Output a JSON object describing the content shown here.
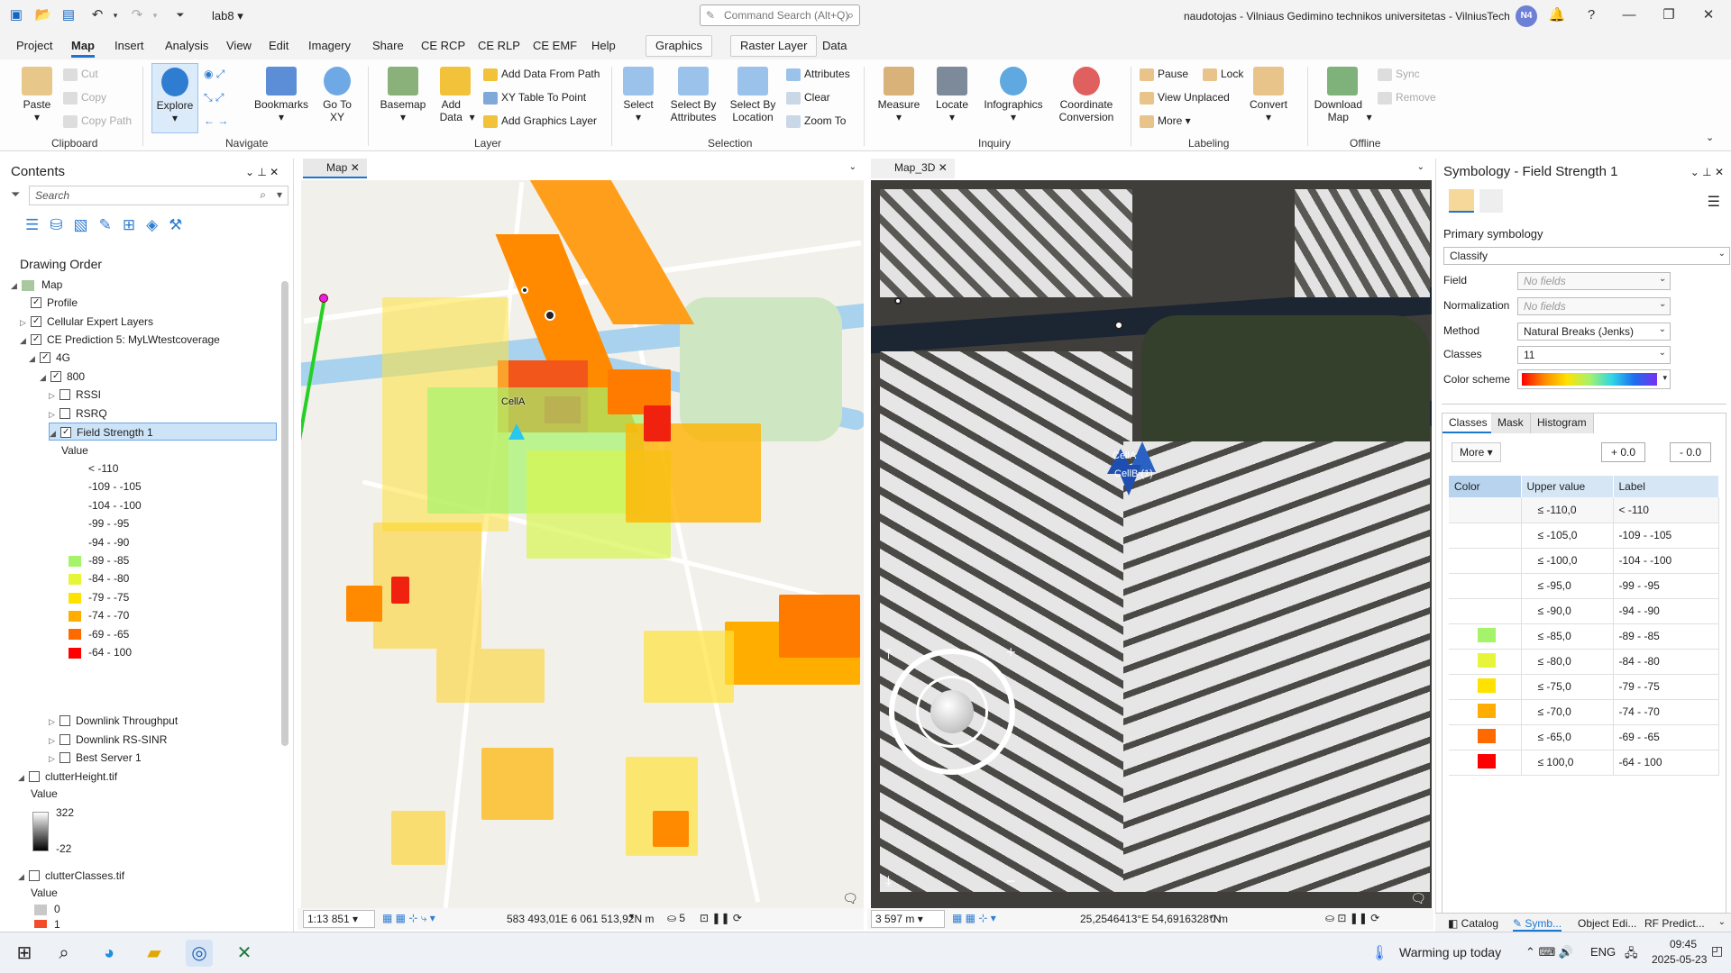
{
  "app": {
    "project": "lab8",
    "command_search": "Command Search (Alt+Q)",
    "user": "naudotojas - Vilniaus Gedimino technikos universitetas - VilniusTech",
    "avatar": "N4"
  },
  "tabs": [
    "Project",
    "Map",
    "Insert",
    "Analysis",
    "View",
    "Edit",
    "Imagery",
    "Share",
    "CE RCP",
    "CE RLP",
    "CE EMF",
    "Help"
  ],
  "context_tabs": [
    "Graphics",
    "Raster Layer",
    "Data"
  ],
  "ribbon": {
    "clipboard": {
      "paste": "Paste",
      "cut": "Cut",
      "copy": "Copy",
      "copy_path": "Copy Path",
      "group": "Clipboard"
    },
    "navigate": {
      "explore": "Explore",
      "bookmarks": "Bookmarks",
      "go_to_xy": "Go To XY",
      "group": "Navigate"
    },
    "layer": {
      "basemap": "Basemap",
      "add_data": "Add Data",
      "add_data_from_path": "Add Data From Path",
      "xy_table": "XY Table To Point",
      "add_graphics": "Add Graphics Layer",
      "group": "Layer"
    },
    "selection": {
      "select": "Select",
      "select_by_attr": "Select By Attributes",
      "select_by_loc": "Select By Location",
      "attributes": "Attributes",
      "clear": "Clear",
      "zoom_to": "Zoom To",
      "group": "Selection"
    },
    "inquiry": {
      "measure": "Measure",
      "locate": "Locate",
      "infographics": "Infographics",
      "coord_conv": "Coordinate Conversion",
      "group": "Inquiry"
    },
    "labeling": {
      "pause": "Pause",
      "lock": "Lock",
      "view_unplaced": "View Unplaced",
      "more": "More",
      "convert": "Convert",
      "group": "Labeling"
    },
    "offline": {
      "download_map": "Download Map",
      "sync": "Sync",
      "remove": "Remove",
      "group": "Offline"
    }
  },
  "contents": {
    "title": "Contents",
    "search": "Search",
    "drawing_order": "Drawing Order",
    "tree": {
      "map": "Map",
      "profile": "Profile",
      "cel_expert": "Cellular Expert Layers",
      "prediction": "CE Prediction 5: MyLWtestcoverage",
      "g4": "4G",
      "f800": "800",
      "rssi": "RSSI",
      "rsrq": "RSRQ",
      "fs1": "Field Strength 1",
      "value": "Value",
      "dl_tp": "Downlink Throughput",
      "dl_rs": "Downlink RS-SINR",
      "best": "Best Server 1",
      "clutter_h": "clutterHeight.tif",
      "value2": "Value",
      "ch_max": "322",
      "ch_min": "-22",
      "clutter_c": "clutterClasses.tif",
      "value3": "Value",
      "cc0": "0",
      "cc1": "1"
    },
    "legend": [
      {
        "label": "< -110",
        "color": ""
      },
      {
        "label": "-109 - -105",
        "color": ""
      },
      {
        "label": "-104 - -100",
        "color": ""
      },
      {
        "label": "-99 - -95",
        "color": ""
      },
      {
        "label": "-94 - -90",
        "color": ""
      },
      {
        "label": "-89 - -85",
        "color": "#a5f36b"
      },
      {
        "label": "-84 - -80",
        "color": "#e7f53a"
      },
      {
        "label": "-79 - -75",
        "color": "#ffe200"
      },
      {
        "label": "-74 - -70",
        "color": "#ffad00"
      },
      {
        "label": "-69 - -65",
        "color": "#ff6a00"
      },
      {
        "label": "-64 - 100",
        "color": "#ff0000"
      }
    ]
  },
  "map2d": {
    "tab": "Map",
    "cell_label": "CellA",
    "scale": "1:13 851",
    "coords": "583 493,01E 6 061 513,92N m",
    "sel_count": "5"
  },
  "map3d": {
    "tab": "Map_3D",
    "cell_a": "CellA",
    "cell_b": "CellB (1)",
    "distance": "3 597 m",
    "coords": "25,2546413°E 54,6916328°N",
    "elev": "0 m"
  },
  "symbology": {
    "title": "Symbology - Field Strength 1",
    "primary": "Primary symbology",
    "classify": "Classify",
    "field_l": "Field",
    "field_v": "No fields",
    "norm_l": "Normalization",
    "norm_v": "No fields",
    "method_l": "Method",
    "method_v": "Natural Breaks (Jenks)",
    "classes_l": "Classes",
    "classes_v": "11",
    "scheme_l": "Color scheme",
    "tabs": [
      "Classes",
      "Mask",
      "Histogram"
    ],
    "more": "More",
    "plus": "+ 0.0",
    "minus": "- 0.0",
    "col_color": "Color",
    "col_upper": "Upper value",
    "col_label": "Label",
    "rows": [
      {
        "upper": "≤   -110,0",
        "label": "< -110",
        "color": ""
      },
      {
        "upper": "≤   -105,0",
        "label": "-109 - -105",
        "color": ""
      },
      {
        "upper": "≤   -100,0",
        "label": "-104 - -100",
        "color": ""
      },
      {
        "upper": "≤   -95,0",
        "label": "-99 - -95",
        "color": ""
      },
      {
        "upper": "≤   -90,0",
        "label": "-94 - -90",
        "color": ""
      },
      {
        "upper": "≤   -85,0",
        "label": "-89 - -85",
        "color": "#a5f36b"
      },
      {
        "upper": "≤   -80,0",
        "label": "-84 - -80",
        "color": "#e7f53a"
      },
      {
        "upper": "≤   -75,0",
        "label": "-79 - -75",
        "color": "#ffe200"
      },
      {
        "upper": "≤   -70,0",
        "label": "-74 - -70",
        "color": "#ffad00"
      },
      {
        "upper": "≤   -65,0",
        "label": "-69 - -65",
        "color": "#ff6a00"
      },
      {
        "upper": "≤   100,0",
        "label": "-64 - 100",
        "color": "#ff0000"
      }
    ]
  },
  "bottom_tabs": [
    "Catalog",
    "Symb...",
    "Object Edi...",
    "RF Predict..."
  ],
  "taskbar": {
    "weather": "Warming up today",
    "lang": "ENG",
    "time": "09:45",
    "date": "2025-05-23"
  },
  "colors": {
    "accent": "#1b76d2",
    "ribbon_bg": "#f3f3f3"
  }
}
